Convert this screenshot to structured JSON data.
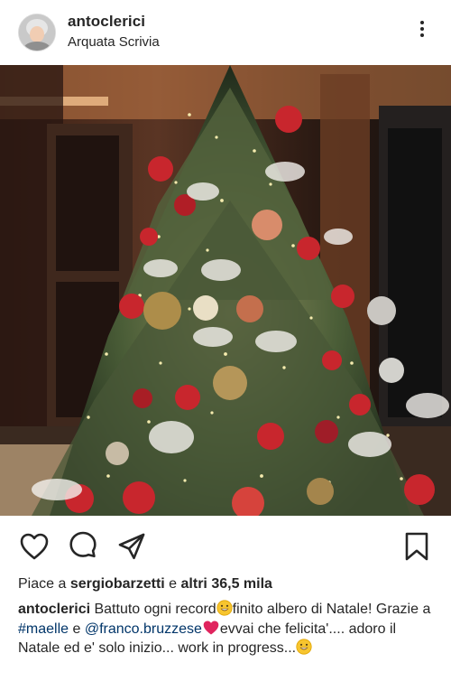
{
  "post": {
    "username": "antoclerici",
    "location": "Arquata Scrivia"
  },
  "likes": {
    "prefix": "Piace a ",
    "user": "sergiobarzetti",
    "middle": " e ",
    "others": "altri 36,5 mila"
  },
  "caption": {
    "username": "antoclerici",
    "text_1": " Battuto ogni record",
    "text_2": "finito albero di Natale! Grazie a ",
    "mention_1": "#maelle",
    "text_3": " e ",
    "mention_2": "@franco.bruzzese",
    "text_4": "evvai che felicita'.... adoro il Natale ed e' solo inizio... work in progress...",
    "emoji_1": "grinning-face",
    "emoji_2": "red-heart",
    "emoji_3": "grinning-face"
  },
  "icons": {
    "like": "heart-outline-icon",
    "comment": "comment-bubble-icon",
    "share": "paper-plane-icon",
    "save": "bookmark-icon",
    "more": "vertical-ellipsis-icon"
  },
  "colors": {
    "text": "#262626",
    "mention": "#003569",
    "heart": "#e0245e"
  }
}
